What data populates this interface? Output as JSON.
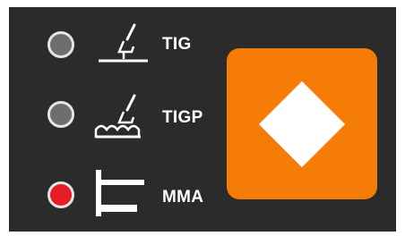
{
  "colors": {
    "panel_bg": "#2b2b2b",
    "led_off": "#6e6e6e",
    "led_on": "#e81c24",
    "accent": "#f57c06",
    "icon": "#ffffff"
  },
  "modes": [
    {
      "label": "TIG",
      "icon": "tig-torch-icon",
      "active": false
    },
    {
      "label": "TIGP",
      "icon": "tig-pulse-torch-icon",
      "active": false
    },
    {
      "label": "MMA",
      "icon": "mma-electrode-icon",
      "active": true
    }
  ],
  "select_button": {
    "icon": "diamond-icon"
  }
}
